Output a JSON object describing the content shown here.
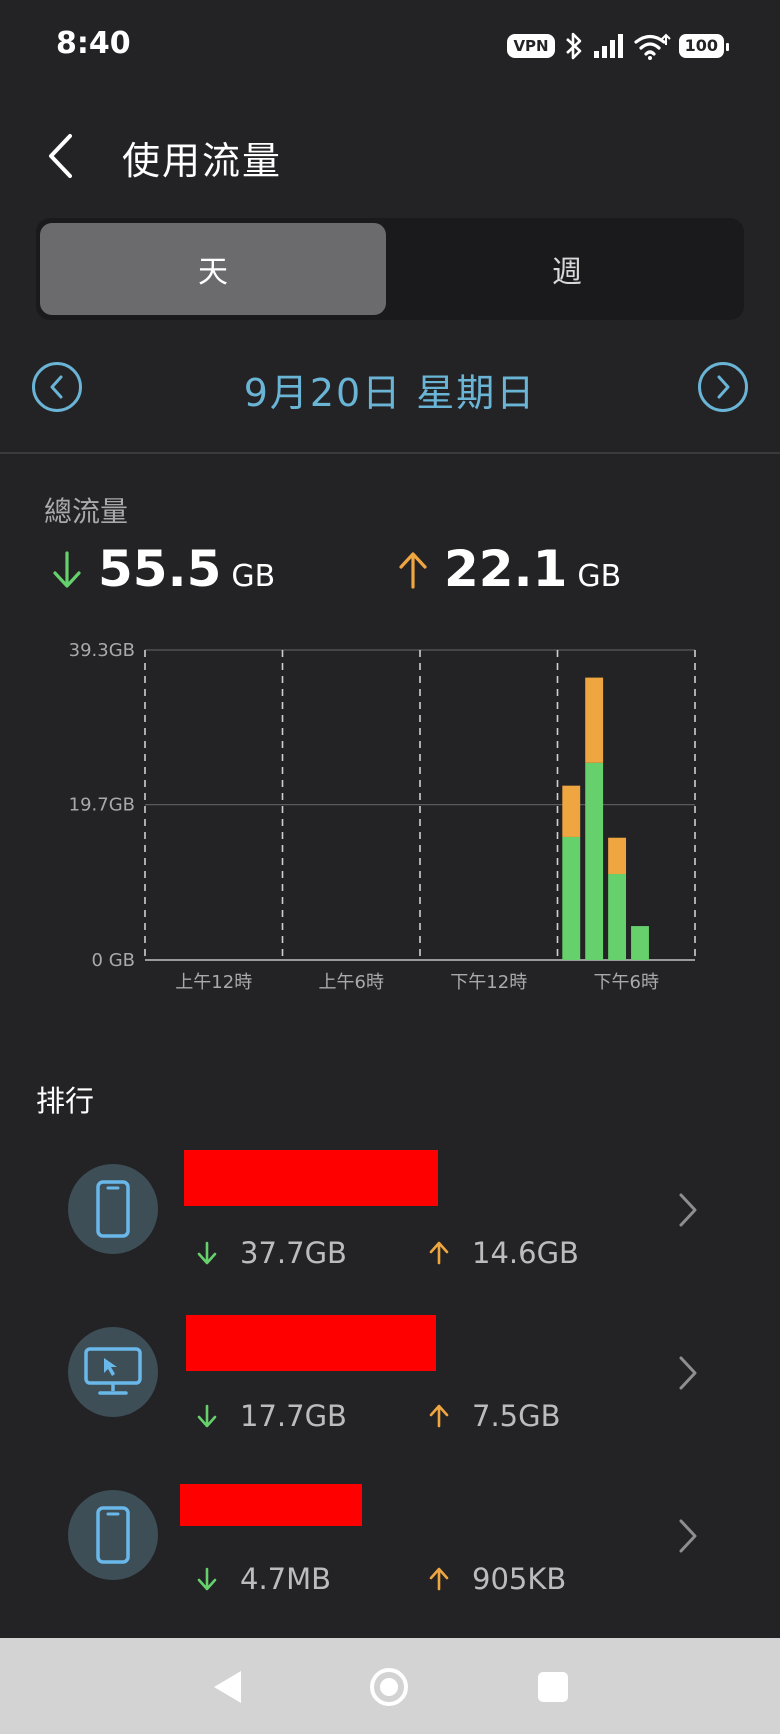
{
  "status_bar": {
    "time": "8:40",
    "vpn": "VPN",
    "battery": "100",
    "icons": [
      "bluetooth-icon",
      "signal-icon",
      "wifi-icon"
    ]
  },
  "header": {
    "title": "使用流量",
    "back_icon": "back-arrow-icon"
  },
  "segmented": {
    "day": "天",
    "week": "週",
    "selected": "day"
  },
  "date_nav": {
    "label": "9月20日 星期日"
  },
  "totals": {
    "label": "總流量",
    "download_value": "55.5",
    "download_unit": "GB",
    "upload_value": "22.1",
    "upload_unit": "GB"
  },
  "colors": {
    "accent": "#6ab4d6",
    "download": "#66d16c",
    "upload": "#f0a640",
    "background": "#232325"
  },
  "chart_data": {
    "type": "bar",
    "stacked": true,
    "title": "",
    "xlabel": "",
    "ylabel": "",
    "y_ticks": [
      "39.3GB",
      "19.7GB",
      "0 GB"
    ],
    "y_tick_values": [
      39.3,
      19.7,
      0
    ],
    "ylim": [
      0,
      39.3
    ],
    "x_ticks": [
      "上午12時",
      "上午6時",
      "下午12時",
      "下午6時"
    ],
    "hours": [
      "18",
      "19",
      "20",
      "21"
    ],
    "series": [
      {
        "name": "download",
        "color": "#66d16c",
        "values": [
          15.6,
          25.0,
          10.9,
          4.3
        ]
      },
      {
        "name": "upload",
        "color": "#f0a640",
        "values": [
          6.5,
          10.8,
          4.6,
          0
        ]
      }
    ],
    "grid": true
  },
  "ranking": {
    "title": "排行",
    "items": [
      {
        "icon": "phone-icon",
        "download": "37.7GB",
        "upload": "14.6GB"
      },
      {
        "icon": "monitor-icon",
        "download": "17.7GB",
        "upload": "7.5GB"
      },
      {
        "icon": "phone-icon",
        "download": "4.7MB",
        "upload": "905KB"
      }
    ]
  }
}
